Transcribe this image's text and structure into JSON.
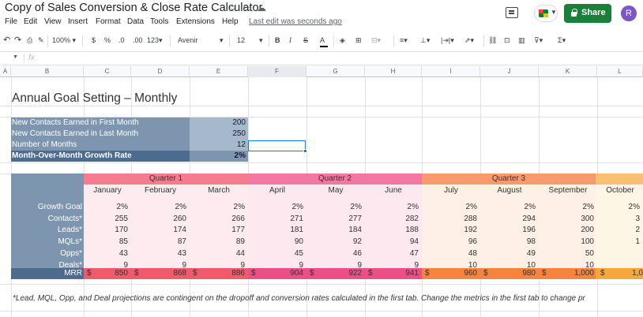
{
  "title": "Copy of Sales Conversion & Close Rate Calculator",
  "menus": [
    "File",
    "Edit",
    "View",
    "Insert",
    "Format",
    "Data",
    "Tools",
    "Extensions",
    "Help"
  ],
  "last_edit": "Last edit was seconds ago",
  "share_label": "Share",
  "avatar_letter": "R",
  "toolbar": {
    "zoom": "100%",
    "currency": "$",
    "percent": "%",
    "dec_dec": ".0",
    "inc_dec": ".00",
    "format_more": "123",
    "font": "Avenir",
    "font_size": "12"
  },
  "formula": {
    "fx": "fx"
  },
  "columns": [
    "A",
    "B",
    "C",
    "D",
    "E",
    "F",
    "G",
    "H",
    "I",
    "J",
    "K",
    "L"
  ],
  "sheet_title": "Annual Goal Setting – Monthly",
  "inputs": [
    {
      "label": "New Contacts Earned in First Month",
      "value": "200"
    },
    {
      "label": "New Contacts Earned in Last Month",
      "value": "250"
    },
    {
      "label": "Number of Months",
      "value": "12"
    },
    {
      "label": "Month-Over-Month Growth Rate",
      "value": "2%"
    }
  ],
  "quarters": [
    "Quarter 1",
    "Quarter 2",
    "Quarter 3",
    ""
  ],
  "months": [
    "January",
    "February",
    "March",
    "April",
    "May",
    "June",
    "July",
    "August",
    "September",
    "October"
  ],
  "rows": [
    {
      "label": "Growth Goal",
      "values": [
        "2%",
        "2%",
        "2%",
        "2%",
        "2%",
        "2%",
        "2%",
        "2%",
        "2%",
        "2%"
      ]
    },
    {
      "label": "Contacts*",
      "values": [
        "255",
        "260",
        "266",
        "271",
        "277",
        "282",
        "288",
        "294",
        "300",
        "3"
      ]
    },
    {
      "label": "Leads*",
      "values": [
        "170",
        "174",
        "177",
        "181",
        "184",
        "188",
        "192",
        "196",
        "200",
        "2"
      ]
    },
    {
      "label": "MQLs*",
      "values": [
        "85",
        "87",
        "89",
        "90",
        "92",
        "94",
        "96",
        "98",
        "100",
        "1"
      ]
    },
    {
      "label": "Opps*",
      "values": [
        "43",
        "43",
        "44",
        "45",
        "46",
        "47",
        "48",
        "49",
        "50",
        ""
      ]
    },
    {
      "label": "Deals*",
      "values": [
        "9",
        "9",
        "9",
        "9",
        "9",
        "9",
        "10",
        "10",
        "10",
        ""
      ]
    }
  ],
  "mrr": {
    "label": "MRR",
    "currency": "$",
    "values": [
      "850",
      "868",
      "886",
      "904",
      "922",
      "941",
      "960",
      "980",
      "1,000",
      "1,0"
    ]
  },
  "footnote": "*Lead, MQL, Opp, and Deal projections are contingent on the dropoff and conversion rates calculated in the first tab. Change the metrics in the first tab to change pr",
  "colors": {
    "share": "#188038",
    "selection": "#1a73e8",
    "label_col": "#7e95b0",
    "growth_row": "#4d6b8c"
  }
}
